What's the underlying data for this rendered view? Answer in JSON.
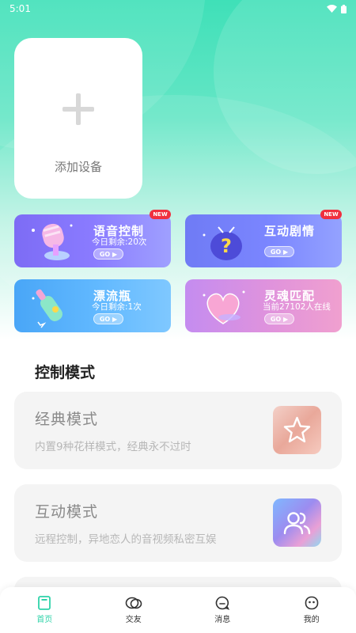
{
  "status_bar": {
    "time": "5:01"
  },
  "colors": {
    "accent": "#2fd3a9",
    "badge": "#f0303f"
  },
  "add_device": {
    "label": "添加设备",
    "icon": "plus-icon"
  },
  "features": [
    {
      "title": "语音控制",
      "sub": "今日剩余:20次",
      "go": "GO ▶",
      "badge": "NEW",
      "icon": "voice-mic-icon"
    },
    {
      "title": "互动剧情",
      "sub": "",
      "go": "GO ▶",
      "badge": "NEW",
      "icon": "tv-character-icon"
    },
    {
      "title": "漂流瓶",
      "sub": "今日剩余:1次",
      "go": "GO ▶",
      "icon": "bottle-icon"
    },
    {
      "title": "灵魂匹配",
      "sub": "当前27102人在线",
      "go": "GO ▶",
      "icon": "heart-icon"
    }
  ],
  "section": {
    "title": "控制模式"
  },
  "modes": [
    {
      "title": "经典模式",
      "desc": "内置9种花样模式，经典永不过时",
      "icon": "star-icon"
    },
    {
      "title": "互动模式",
      "desc": "远程控制，异地恋人的音视频私密互娱",
      "icon": "users-icon"
    }
  ],
  "nav": [
    {
      "label": "首页",
      "icon": "home-icon",
      "active": true
    },
    {
      "label": "交友",
      "icon": "friends-icon",
      "active": false
    },
    {
      "label": "消息",
      "icon": "message-icon",
      "active": false
    },
    {
      "label": "我的",
      "icon": "profile-icon",
      "active": false
    }
  ]
}
